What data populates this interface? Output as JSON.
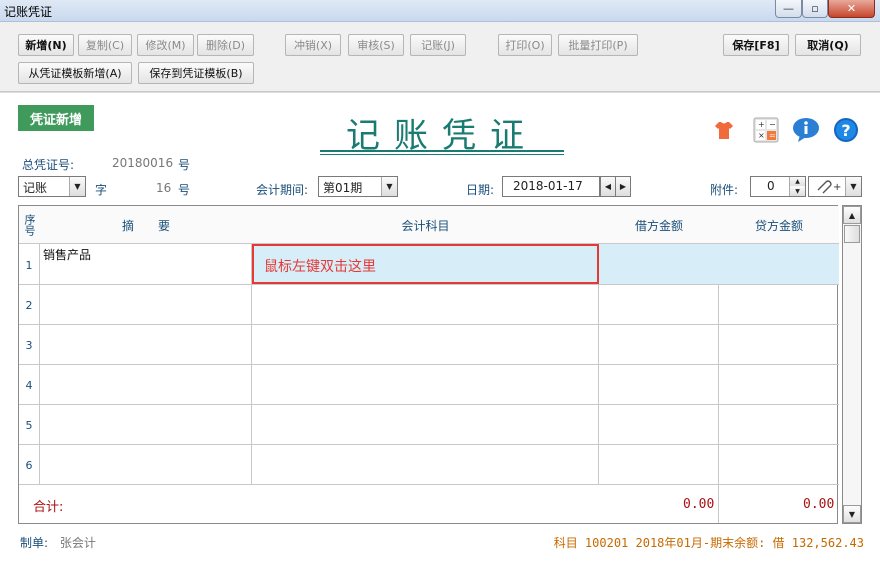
{
  "window": {
    "title": "记账凭证",
    "min": "—",
    "max": "▫",
    "close": "✕"
  },
  "toolbar": {
    "add": "新增(N)",
    "copy": "复制(C)",
    "edit": "修改(M)",
    "delete": "删除(D)",
    "reverse": "冲销(X)",
    "audit": "审核(S)",
    "post": "记账(J)",
    "print": "打印(O)",
    "batch_print": "批量打印(P)",
    "save": "保存[F8]",
    "cancel": "取消(Q)",
    "from_template": "从凭证模板新增(A)",
    "save_template": "保存到凭证模板(B)"
  },
  "voucher": {
    "badge": "凭证新增",
    "title": "记账凭证",
    "total_no_label": "总凭证号:",
    "total_no": "20180016",
    "hao": "号",
    "type": "记账",
    "zi": "字",
    "number": "16",
    "period_label": "会计期间:",
    "period": "第01期",
    "date_label": "日期:",
    "date": "2018-01-17",
    "attach_label": "附件:",
    "attach": "0"
  },
  "table": {
    "headers": {
      "seq": "序号",
      "summary": "摘　　要",
      "account": "会计科目",
      "debit": "借方金额",
      "credit": "贷方金额"
    },
    "rows": [
      {
        "no": "1",
        "summary": "销售产品",
        "account": "鼠标左键双击这里"
      },
      {
        "no": "2"
      },
      {
        "no": "3"
      },
      {
        "no": "4"
      },
      {
        "no": "5"
      },
      {
        "no": "6"
      }
    ],
    "total_label": "合计:",
    "total_debit": "0.00",
    "total_credit": "0.00"
  },
  "footer": {
    "maker_label": "制单:",
    "maker": "张会计",
    "status": "科目 100201  2018年01月-期末余额: 借 132,562.43"
  },
  "colors": {
    "accent": "#1a7b72",
    "badge": "#3f9a5c",
    "highlight": "#e53935"
  }
}
